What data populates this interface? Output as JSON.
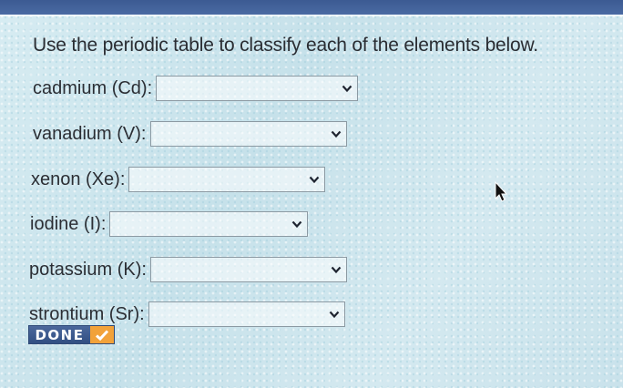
{
  "prompt": "Use the periodic table to classify each of the elements below.",
  "elements": [
    {
      "label": "cadmium (Cd):",
      "value": ""
    },
    {
      "label": "vanadium (V):",
      "value": ""
    },
    {
      "label": "xenon (Xe):",
      "value": ""
    },
    {
      "label": "iodine (I):",
      "value": ""
    },
    {
      "label": "potassium (K):",
      "value": ""
    },
    {
      "label": "strontium (Sr):",
      "value": ""
    }
  ],
  "done_button": {
    "label": "DONE"
  },
  "colors": {
    "accent": "#3c5a92",
    "check": "#f2a23a"
  },
  "icons": {
    "dropdown": "chevron-down-icon",
    "done": "check-icon",
    "pointer": "mouse-cursor-icon"
  }
}
